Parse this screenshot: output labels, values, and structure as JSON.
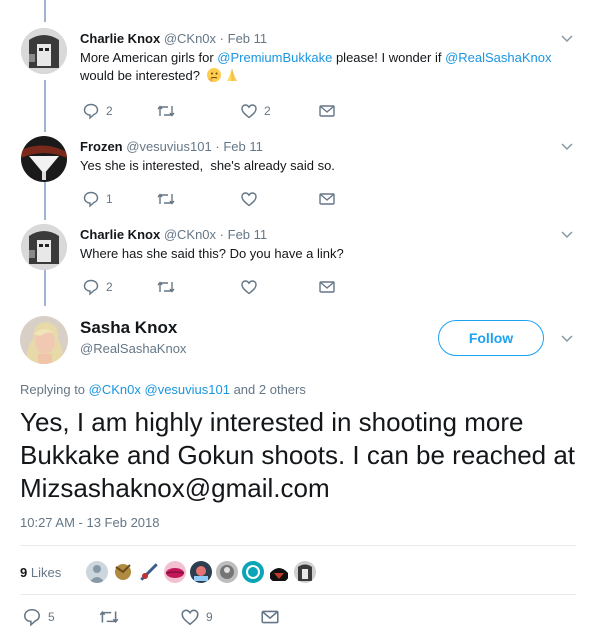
{
  "replies": [
    {
      "name": "Charlie Knox",
      "handle": "@CKn0x",
      "sep": "·",
      "date": "Feb 11",
      "text_before": "More American girls for ",
      "mention1": "@PremiumBukkake",
      "text_middle": " please! I wonder if ",
      "mention2": "@RealSashaKnox",
      "text_after": "would be interested?",
      "reply_count": "2",
      "like_count": "2"
    },
    {
      "name": "Frozen",
      "handle": "@vesuvius101",
      "sep": "·",
      "date": "Feb 11",
      "text": "Yes she is interested,  she's already said so.",
      "reply_count": "1"
    },
    {
      "name": "Charlie Knox",
      "handle": "@CKn0x",
      "sep": "·",
      "date": "Feb 11",
      "text": "Where has she said this? Do you have a link?",
      "reply_count": "2"
    }
  ],
  "main": {
    "name": "Sasha Knox",
    "handle": "@RealSashaKnox",
    "follow_label": "Follow",
    "replying_prefix": "Replying to ",
    "replying_mention1": "@CKn0x",
    "replying_mention2": "@vesuvius101",
    "replying_suffix": " and 2 others",
    "text": "Yes, I am highly interested in shooting more Bukkake and Gokun shoots. I can be reached at Mizsashaknox@gmail.com",
    "timestamp": "10:27 AM - 13 Feb 2018",
    "likes_count": "9",
    "likes_label": "Likes",
    "reply_count": "5",
    "like_count": "9"
  },
  "colors": {
    "link": "#1b95e0",
    "follow": "#1da1f2",
    "muted": "#657786",
    "thread_line": "#9fb4d2"
  },
  "icons": [
    "reply-icon",
    "retweet-icon",
    "like-icon",
    "dm-icon",
    "chevron-down-icon"
  ]
}
